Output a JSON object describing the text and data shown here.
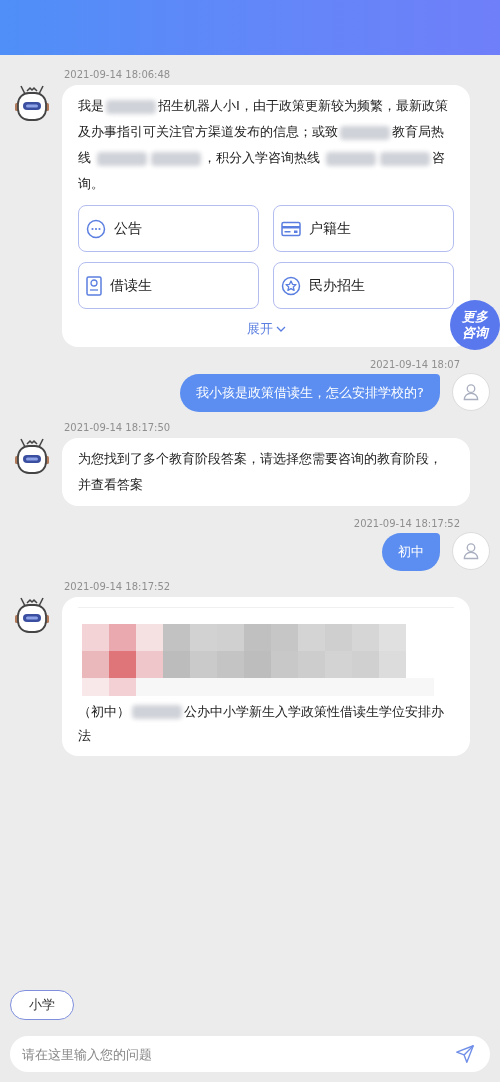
{
  "more_button": {
    "lines": [
      "更多",
      "咨询"
    ]
  },
  "messages": [
    {
      "kind": "bot",
      "time": "2021-09-14 18:06:48",
      "segments": [
        {
          "kind": "text",
          "text": "我是"
        },
        {
          "kind": "redacted"
        },
        {
          "kind": "text",
          "text": "招生机器人小I，由于政策更新较为频繁，最新政策及办事指引可关注官方渠道发布的信息；或致"
        },
        {
          "kind": "redacted"
        },
        {
          "kind": "text",
          "text": "教育局热线 "
        },
        {
          "kind": "redacted"
        },
        {
          "kind": "redacted"
        },
        {
          "kind": "text",
          "text": "，积分入学咨询热线 "
        },
        {
          "kind": "redacted"
        },
        {
          "kind": "redacted"
        },
        {
          "kind": "text",
          "text": "咨询。"
        }
      ],
      "options": [
        {
          "kind": "notice",
          "label": "公告"
        },
        {
          "kind": "card",
          "label": "户籍生"
        },
        {
          "kind": "document",
          "label": "借读生"
        },
        {
          "kind": "star",
          "label": "民办招生"
        }
      ],
      "expand": "展开"
    },
    {
      "kind": "user",
      "time": "2021-09-14 18:07",
      "segments": [
        {
          "kind": "text",
          "text": "我小孩是政策借读生，怎么安排学校的?"
        }
      ]
    },
    {
      "kind": "bot",
      "time": "2021-09-14 18:17:50",
      "segments": [
        {
          "kind": "text",
          "text": "为您找到了多个教育阶段答案，请选择您需要咨询的教育阶段，并查看答案"
        }
      ]
    },
    {
      "kind": "user",
      "time": "2021-09-14 18:17:52",
      "segments": [
        {
          "kind": "text",
          "text": "初中"
        }
      ]
    },
    {
      "kind": "bot",
      "time": "2021-09-14 18:17:52",
      "card": {
        "kind": "picture",
        "segments": [
          {
            "kind": "text",
            "text": "（初中）"
          },
          {
            "kind": "redacted"
          },
          {
            "kind": "text",
            "text": "公办中小学新生入学政策性借读生学位安排办法"
          }
        ]
      }
    }
  ],
  "quick_replies": [
    {
      "label": "小学"
    }
  ],
  "input": {
    "placeholder": "请在这里输入您的问题"
  }
}
